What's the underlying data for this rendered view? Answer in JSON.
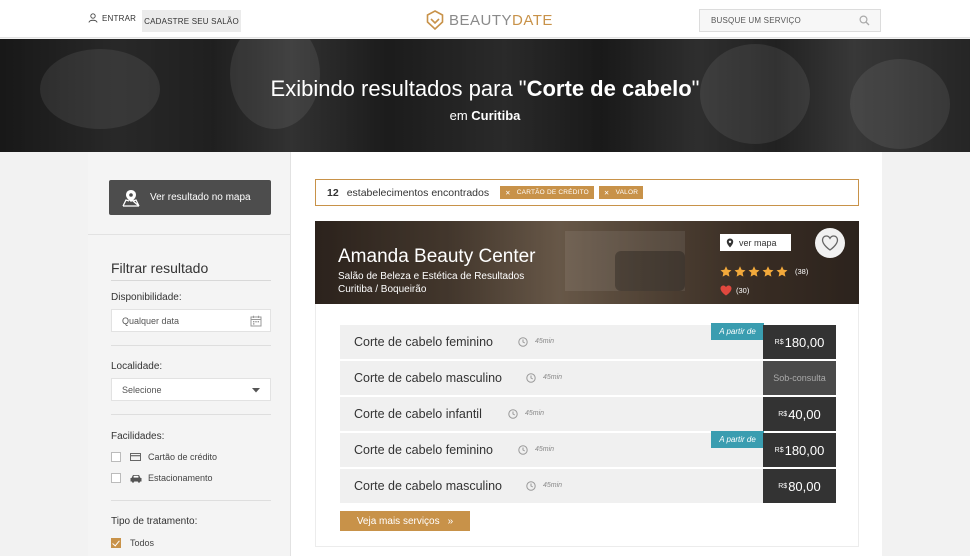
{
  "header": {
    "login_label": "ENTRAR",
    "register_label": "CADASTRE SEU SALÃO",
    "logo_part1": "BEAUTY",
    "logo_part2": "DATE",
    "search_placeholder": "BUSQUE UM SERVIÇO"
  },
  "hero": {
    "title_prefix": "Exibindo resultados para \"",
    "query": "Corte de cabelo",
    "title_suffix": "\"",
    "sub_prefix": "em ",
    "city": "Curitiba"
  },
  "sidebar": {
    "map_button": "Ver resultado no mapa",
    "filter_title": "Filtrar resultado",
    "availability_label": "Disponibilidade:",
    "availability_value": "Qualquer data",
    "location_label": "Localidade:",
    "location_value": "Selecione",
    "facilities_label": "Facilidades:",
    "facilities": [
      {
        "label": "Cartão de crédito",
        "icon": "credit-card-icon",
        "checked": false
      },
      {
        "label": "Estacionamento",
        "icon": "car-icon",
        "checked": false
      }
    ],
    "treatment_label": "Tipo de tratamento:",
    "treatment_options": [
      {
        "label": "Todos",
        "checked": true
      }
    ]
  },
  "results": {
    "count": "12",
    "count_text": "estabelecimentos encontrados",
    "tags": [
      "CARTÃO DE CRÉDITO",
      "VALOR"
    ]
  },
  "salon": {
    "name": "Amanda Beauty Center",
    "subtitle": "Salão de Beleza e Estética de Resultados",
    "location": "Curitiba / Boqueirão",
    "map_label": "ver mapa",
    "rating_count": "(38)",
    "likes_count": "(30)",
    "stars": 5
  },
  "services": [
    {
      "name": "Corte de cabelo feminino",
      "duration": "45min",
      "currency": "R$",
      "price": "180,00",
      "from_label": "A partir de"
    },
    {
      "name": "Corte de cabelo masculino",
      "duration": "45min",
      "currency": "",
      "price": "Sob-consulta",
      "from_label": ""
    },
    {
      "name": "Corte de cabelo infantil",
      "duration": "45min",
      "currency": "R$",
      "price": "40,00",
      "from_label": ""
    },
    {
      "name": "Corte de cabelo feminino",
      "duration": "45min",
      "currency": "R$",
      "price": "180,00",
      "from_label": "A partir de"
    },
    {
      "name": "Corte de cabelo masculino",
      "duration": "45min",
      "currency": "R$",
      "price": "80,00",
      "from_label": ""
    }
  ],
  "more_button": "Veja mais serviços",
  "colors": {
    "accent": "#c89249",
    "teal": "#3a9db0",
    "dark": "#333333"
  }
}
